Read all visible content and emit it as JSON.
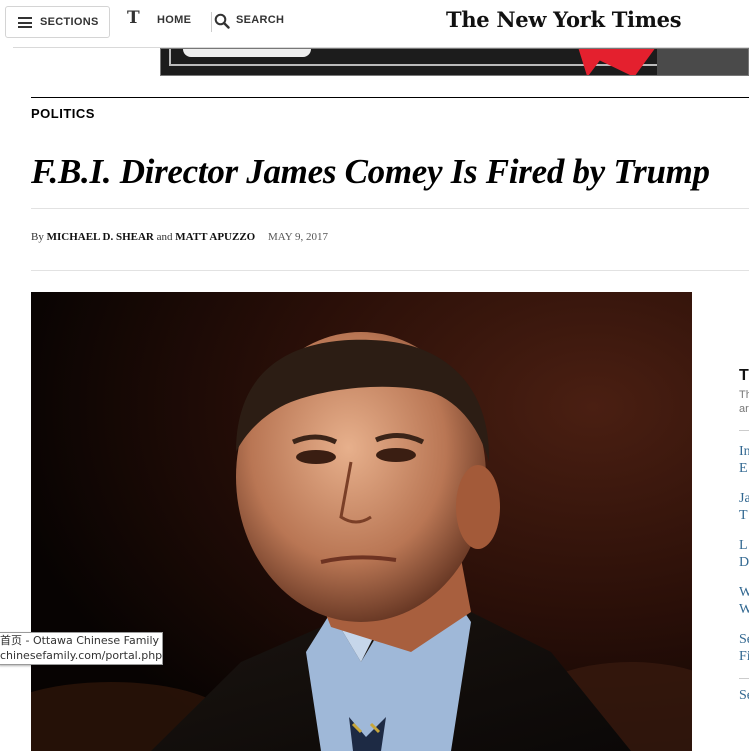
{
  "nav": {
    "sections_label": "SECTIONS",
    "home_label": "HOME",
    "search_label": "SEARCH",
    "masthead": "The New York Times",
    "home_icon_glyph": "ᵗ",
    "t_glyph": "T"
  },
  "article": {
    "kicker": "POLITICS",
    "headline": "F.B.I. Director James Comey Is Fired by Trump",
    "byline_prefix": "By",
    "author_1": "MICHAEL D. SHEAR",
    "byline_and": "and",
    "author_2": "MATT APUZZO",
    "date": "MAY 9, 2017"
  },
  "sidebar": {
    "title": "T",
    "sub_lines": [
      "Th",
      "ar"
    ],
    "links": [
      {
        "line1": "In",
        "line2": "E"
      },
      {
        "line1": "Ja",
        "line2": "T"
      },
      {
        "line1": "L",
        "line2": "D"
      },
      {
        "line1": "W",
        "line2": "W"
      },
      {
        "line1": "Se",
        "line2": "Fi"
      },
      {
        "line1": "Se",
        "line2": ""
      }
    ]
  },
  "tooltip": {
    "title": "首页 - Ottawa Chinese Family",
    "url": "chinesefamily.com/portal.php"
  },
  "colors": {
    "link": "#326891",
    "ad_red": "#e4202e",
    "text": "#000000"
  }
}
